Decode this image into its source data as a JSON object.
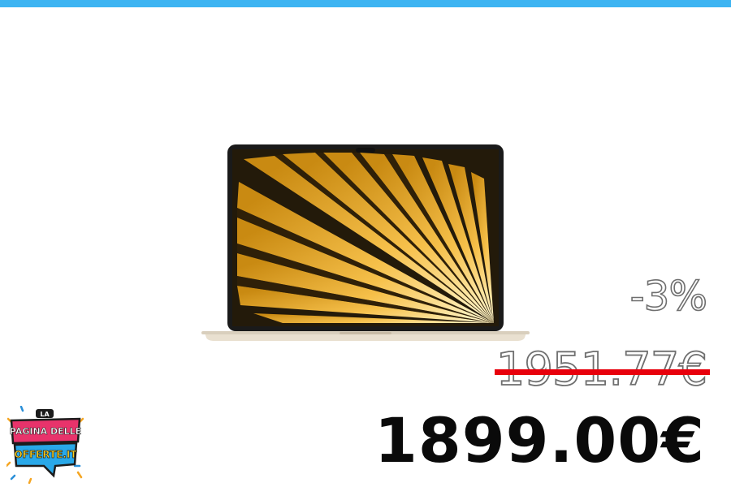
{
  "product": {
    "image_icon": "laptop-icon"
  },
  "pricing": {
    "discount": "-3%",
    "old_price": "1951.77€",
    "price": "1899.00€"
  },
  "brand": {
    "logo_icon": "la-pagina-delle-offerte-logo",
    "line1": "LA",
    "line2": "PAGINA DELLE",
    "line3": "OFFERTE.IT"
  },
  "colors": {
    "top_bar": "#3db4f2",
    "strike": "#e8000c",
    "price": "#0a0a0a"
  }
}
